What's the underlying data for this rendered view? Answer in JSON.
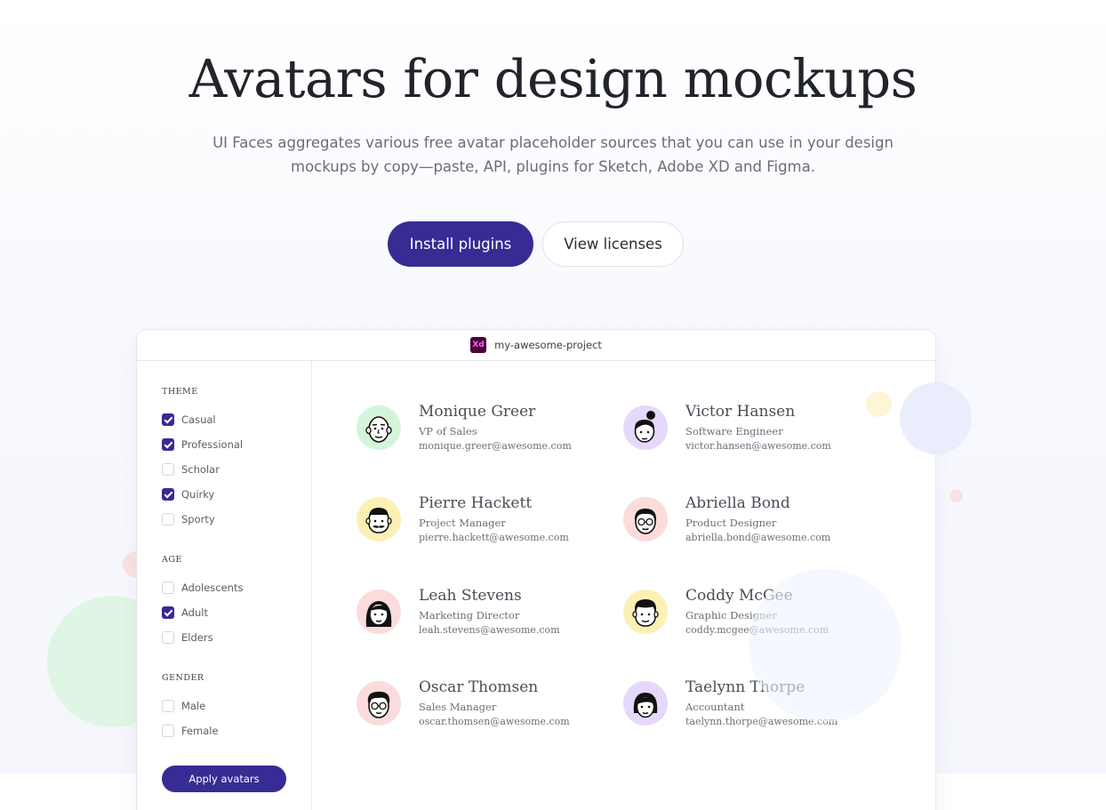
{
  "hero": {
    "title": "Avatars for design mockups",
    "subtitle_line1": "UI Faces aggregates various free avatar placeholder sources that you can use in your design",
    "subtitle_line2": "mockups by copy—paste, API, plugins for Sketch, Adobe XD and Figma.",
    "primary_button": "Install plugins",
    "secondary_button": "View licenses"
  },
  "window": {
    "app_icon_label": "Xd",
    "project_name": "my-awesome-project"
  },
  "sidebar": {
    "theme": {
      "title": "THEME",
      "options": [
        {
          "label": "Casual",
          "checked": true
        },
        {
          "label": "Professional",
          "checked": true
        },
        {
          "label": "Scholar",
          "checked": false
        },
        {
          "label": "Quirky",
          "checked": true
        },
        {
          "label": "Sporty",
          "checked": false
        }
      ]
    },
    "age": {
      "title": "AGE",
      "options": [
        {
          "label": "Adolescents",
          "checked": false
        },
        {
          "label": "Adult",
          "checked": true
        },
        {
          "label": "Elders",
          "checked": false
        }
      ]
    },
    "gender": {
      "title": "GENDER",
      "options": [
        {
          "label": "Male",
          "checked": false
        },
        {
          "label": "Female",
          "checked": false
        }
      ]
    },
    "apply_button": "Apply avatars"
  },
  "people": [
    {
      "name": "Monique Greer",
      "role": "VP of Sales",
      "email": "monique.greer@awesome.com",
      "avatar_bg": "#d5f5da",
      "icon": "bald-man-icon"
    },
    {
      "name": "Victor Hansen",
      "role": "Software Engineer",
      "email": "victor.hansen@awesome.com",
      "avatar_bg": "#e6d8fb",
      "icon": "bun-hair-woman-icon"
    },
    {
      "name": "Pierre Hackett",
      "role": "Project Manager",
      "email": "pierre.hackett@awesome.com",
      "avatar_bg": "#fdf0b5",
      "icon": "mustache-man-icon"
    },
    {
      "name": "Abriella Bond",
      "role": "Product Designer",
      "email": "abriella.bond@awesome.com",
      "avatar_bg": "#fbdcdc",
      "icon": "glasses-woman-icon"
    },
    {
      "name": "Leah Stevens",
      "role": "Marketing Director",
      "email": "leah.stevens@awesome.com",
      "avatar_bg": "#fbdcdc",
      "icon": "long-hair-woman-icon"
    },
    {
      "name": "Coddy McGee",
      "role": "Graphic Designer",
      "email": "coddy.mcgee@awesome.com",
      "avatar_bg": "#fdf0b5",
      "icon": "short-hair-man-icon"
    },
    {
      "name": "Oscar Thomsen",
      "role": "Sales Manager",
      "email": "oscar.thomsen@awesome.com",
      "avatar_bg": "#fbdcdc",
      "icon": "glasses-man-icon"
    },
    {
      "name": "Taelynn Thorpe",
      "role": "Accountant",
      "email": "taelynn.thorpe@awesome.com",
      "avatar_bg": "#e6d8fb",
      "icon": "bob-hair-woman-icon"
    }
  ],
  "colors": {
    "accent": "#372b94",
    "title_text": "#22242b",
    "muted_text": "#6a6d78"
  }
}
